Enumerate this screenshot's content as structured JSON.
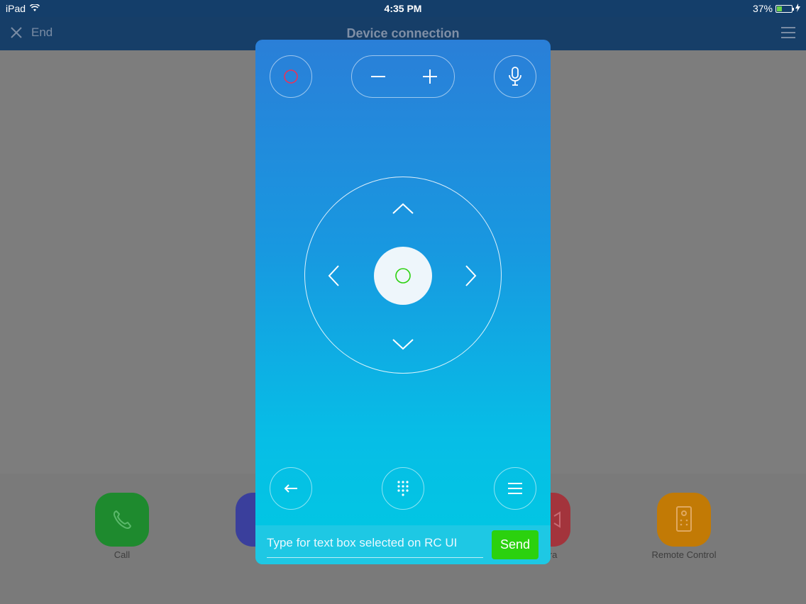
{
  "status_bar": {
    "device": "iPad",
    "time": "4:35 PM",
    "battery_percent": "37%",
    "battery_level": 0.37
  },
  "nav": {
    "end_label": "End",
    "title": "Device connection"
  },
  "apps": [
    {
      "label": "Call",
      "color": "#1e8a2e"
    },
    {
      "label": "",
      "color": "#3a3f9c"
    },
    {
      "label": "era",
      "color": "#a3343c"
    },
    {
      "label": "Remote Control",
      "color": "#c27a05"
    }
  ],
  "remote": {
    "input_placeholder": "Type for text box selected on RC UI",
    "send_label": "Send",
    "colors": {
      "power": "#e8335a",
      "ok_ring": "#2bd10e",
      "send": "#2bd10e"
    }
  }
}
